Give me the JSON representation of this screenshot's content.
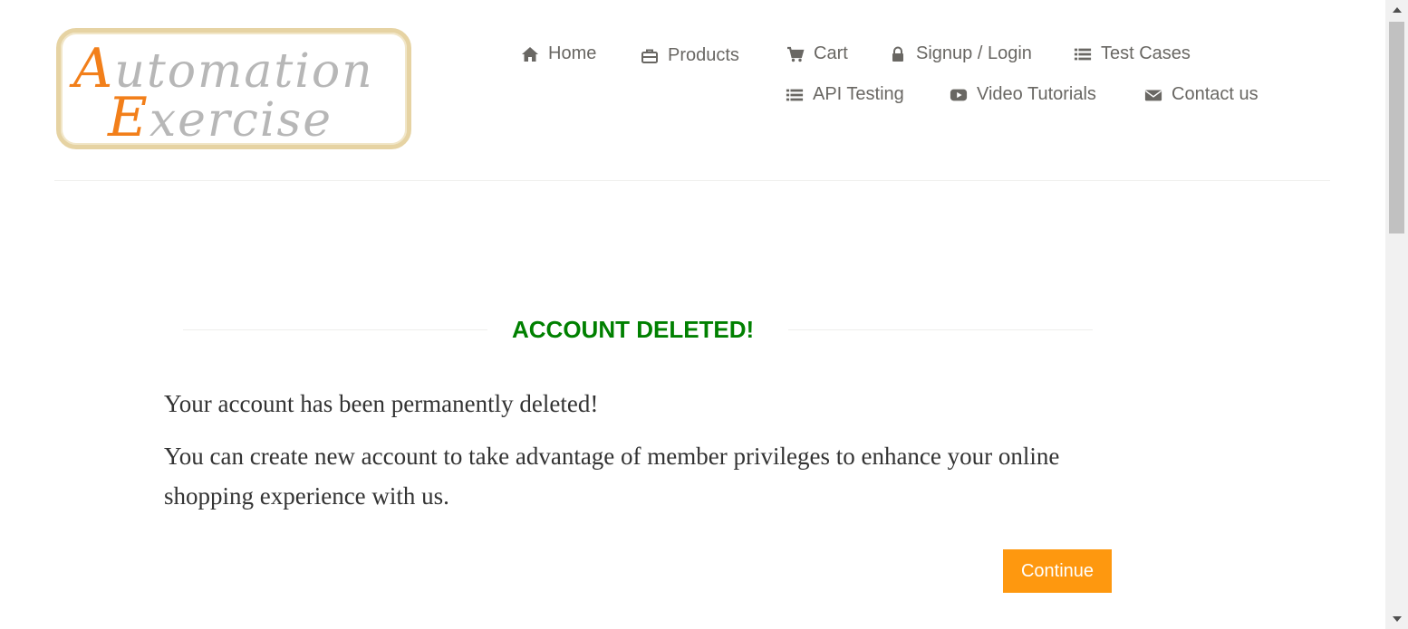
{
  "logo": {
    "line1_cap": "A",
    "line1_rest": "utomation",
    "line2_cap": "E",
    "line2_rest": "xercise"
  },
  "nav": {
    "home": {
      "label": "Home",
      "icon": "home-icon"
    },
    "products": {
      "label": "Products",
      "icon": "briefcase-icon"
    },
    "cart": {
      "label": "Cart",
      "icon": "cart-icon"
    },
    "signup": {
      "label": "Signup / Login",
      "icon": "lock-icon"
    },
    "test_cases": {
      "label": "Test Cases",
      "icon": "list-icon"
    },
    "api_testing": {
      "label": "API Testing",
      "icon": "list-icon"
    },
    "video_tutorials": {
      "label": "Video Tutorials",
      "icon": "youtube-play-icon"
    },
    "contact": {
      "label": "Contact us",
      "icon": "envelope-icon"
    }
  },
  "main": {
    "title": "ACCOUNT DELETED!",
    "message1": "Your account has been permanently deleted!",
    "message2": "You can create new account to take advantage of member privileges to enhance your online shopping experience with us.",
    "continue_label": "Continue"
  },
  "colors": {
    "title": "#008000",
    "button": "#fe980f",
    "logo_accent": "#f27f1a",
    "nav_text": "#696763"
  }
}
